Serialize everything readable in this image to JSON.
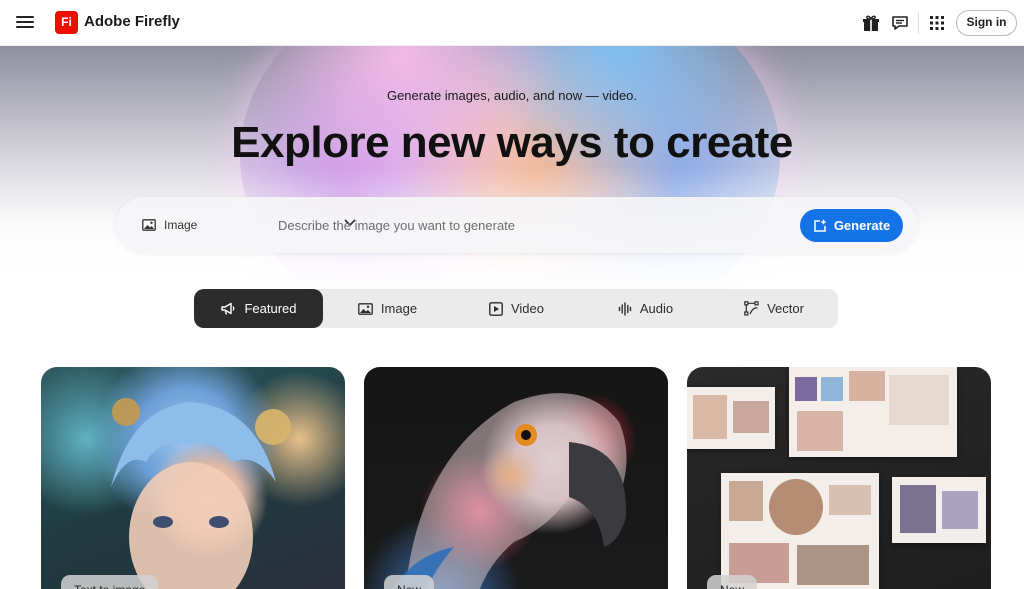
{
  "header": {
    "brand_name": "Adobe Firefly",
    "logo_text": "Fi",
    "sign_in_label": "Sign in",
    "icons": [
      "menu-icon",
      "gift-icon",
      "feedback-icon",
      "apps-grid-icon"
    ]
  },
  "hero": {
    "subtitle": "Generate images, audio, and now — video.",
    "title": "Explore new ways to create"
  },
  "prompt_bar": {
    "type_label": "Image",
    "placeholder": "Describe the image you want to generate",
    "value": "",
    "generate_label": "Generate"
  },
  "tabs": [
    {
      "label": "Featured",
      "icon": "megaphone-icon",
      "active": true
    },
    {
      "label": "Image",
      "icon": "image-icon",
      "active": false
    },
    {
      "label": "Video",
      "icon": "video-icon",
      "active": false
    },
    {
      "label": "Audio",
      "icon": "audio-waveform-icon",
      "active": false
    },
    {
      "label": "Vector",
      "icon": "vector-icon",
      "active": false
    }
  ],
  "cards": [
    {
      "badge": "Text to image",
      "subject": "anime-boy-portrait"
    },
    {
      "badge": "New",
      "subject": "parrot-portrait"
    },
    {
      "badge": "New",
      "subject": "product-moodboard"
    }
  ],
  "colors": {
    "accent": "#1473e6",
    "brand_red": "#eb1000",
    "active_tab": "#2c2c2c"
  }
}
